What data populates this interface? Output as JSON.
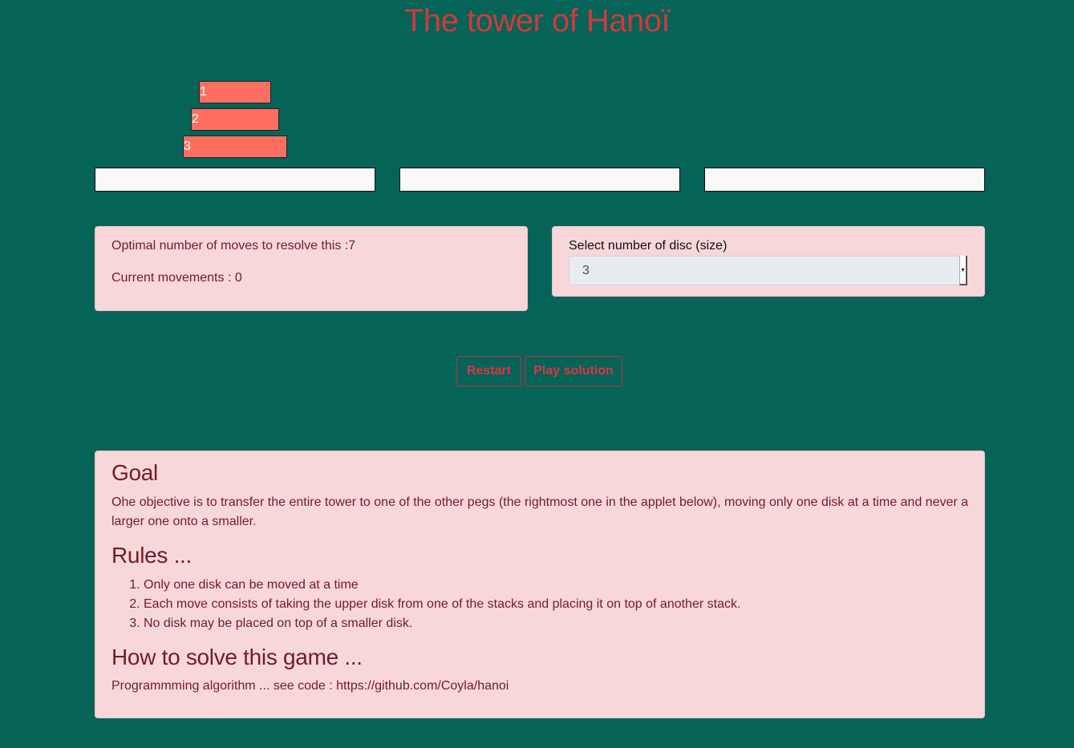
{
  "page": {
    "title": "The tower of Hanoï"
  },
  "game": {
    "disks": [
      {
        "label": "1"
      },
      {
        "label": "2"
      },
      {
        "label": "3"
      }
    ],
    "disk_color": "#ff6f61",
    "peg_count": 3
  },
  "status": {
    "optimal_text": "Optimal number of moves to resolve this :7",
    "current_text": "Current movements : 0"
  },
  "size_select": {
    "label": "Select number of disc (size)",
    "value": "3"
  },
  "controls": {
    "restart_label": "Restart",
    "play_solution_label": "Play solution"
  },
  "help": {
    "goal_heading": "Goal",
    "goal_text": "Ohe objective is to transfer the entire tower to one of the other pegs (the rightmost one in the applet below), moving only one disk at a time and never a larger one onto a smaller.",
    "rules_heading": "Rules ...",
    "rules": [
      "Only one disk can be moved at a time",
      "Each move consists of taking the upper disk from one of the stacks and placing it on top of another stack.",
      "No disk may be placed on top of a smaller disk."
    ],
    "solve_heading": "How to solve this game ...",
    "solve_text": "Programmming algorithm ... see code : https://github.com/Coyla/hanoi"
  },
  "colors": {
    "background": "#056358",
    "title": "#d03a3a",
    "panel_bg": "#f7d7da",
    "panel_text": "#721c24",
    "button": "#dc3545"
  }
}
